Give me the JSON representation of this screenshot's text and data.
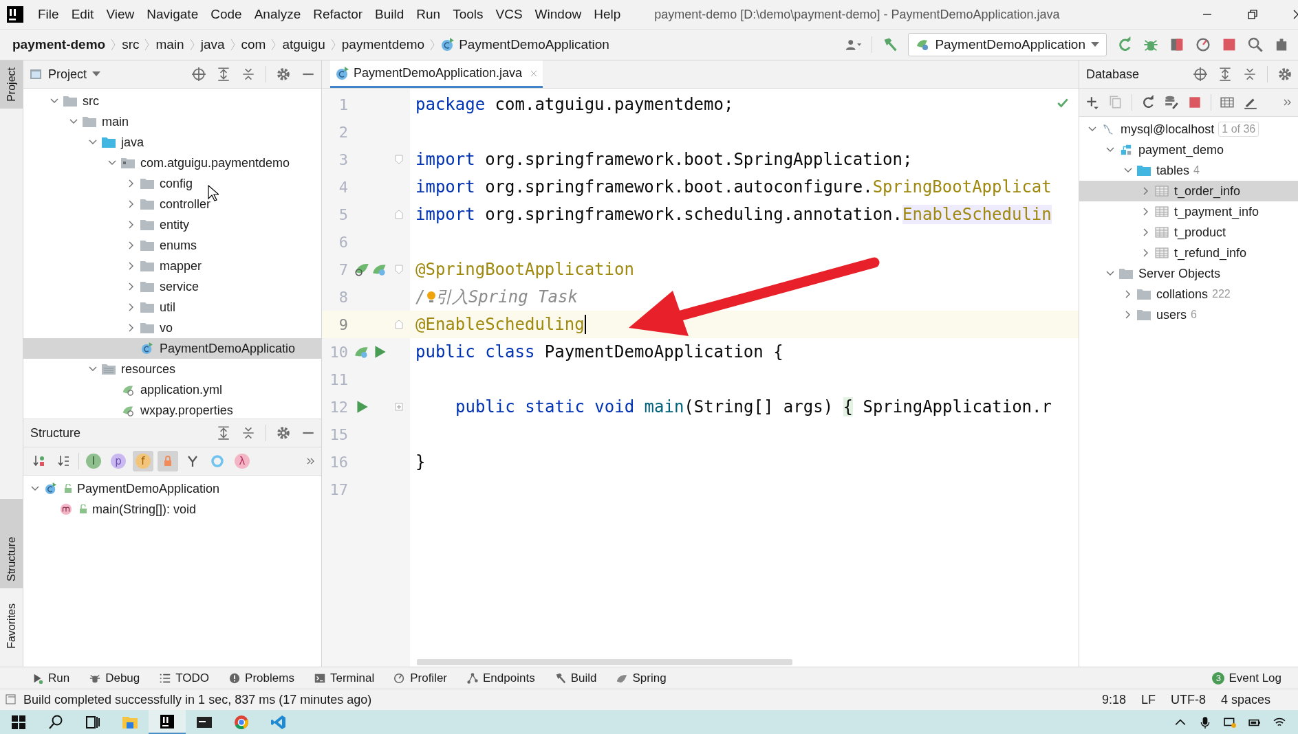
{
  "window": {
    "title": "payment-demo [D:\\demo\\payment-demo] - PaymentDemoApplication.java"
  },
  "menu": [
    "File",
    "Edit",
    "View",
    "Navigate",
    "Code",
    "Analyze",
    "Refactor",
    "Build",
    "Run",
    "Tools",
    "VCS",
    "Window",
    "Help"
  ],
  "breadcrumbs": [
    {
      "label": "payment-demo",
      "kind": "project"
    },
    {
      "label": "src",
      "kind": "dir"
    },
    {
      "label": "main",
      "kind": "dir"
    },
    {
      "label": "java",
      "kind": "dir"
    },
    {
      "label": "com",
      "kind": "dir"
    },
    {
      "label": "atguigu",
      "kind": "dir"
    },
    {
      "label": "paymentdemo",
      "kind": "dir"
    },
    {
      "label": "PaymentDemoApplication",
      "kind": "class"
    }
  ],
  "run_config": {
    "label": "PaymentDemoApplication"
  },
  "left_stripe": [
    {
      "label": "Project",
      "selected": true
    },
    {
      "label": "Structure",
      "selected": true
    },
    {
      "label": "Favorites",
      "selected": false
    }
  ],
  "project": {
    "title": "Project",
    "tree": [
      {
        "label": "src",
        "kind": "folder",
        "expanded": true,
        "selected": false,
        "children": [
          {
            "label": "main",
            "kind": "folder",
            "expanded": true,
            "selected": false,
            "children": [
              {
                "label": "java",
                "kind": "source",
                "expanded": true,
                "selected": false,
                "children": [
                  {
                    "label": "com.atguigu.paymentdemo",
                    "kind": "package",
                    "expanded": true,
                    "selected": false,
                    "children": [
                      {
                        "label": "config",
                        "kind": "folder",
                        "expanded": false,
                        "selected": false
                      },
                      {
                        "label": "controller",
                        "kind": "folder",
                        "expanded": false,
                        "selected": false
                      },
                      {
                        "label": "entity",
                        "kind": "folder",
                        "expanded": false,
                        "selected": false
                      },
                      {
                        "label": "enums",
                        "kind": "folder",
                        "expanded": false,
                        "selected": false
                      },
                      {
                        "label": "mapper",
                        "kind": "folder",
                        "expanded": false,
                        "selected": false
                      },
                      {
                        "label": "service",
                        "kind": "folder",
                        "expanded": false,
                        "selected": false
                      },
                      {
                        "label": "util",
                        "kind": "folder",
                        "expanded": false,
                        "selected": false
                      },
                      {
                        "label": "vo",
                        "kind": "folder",
                        "expanded": false,
                        "selected": false
                      },
                      {
                        "label": "PaymentDemoApplicatio",
                        "kind": "class",
                        "selected": true
                      }
                    ]
                  }
                ]
              },
              {
                "label": "resources",
                "kind": "resources",
                "expanded": true,
                "selected": false,
                "children": [
                  {
                    "label": "application.yml",
                    "kind": "config-file",
                    "selected": false
                  },
                  {
                    "label": "wxpay.properties",
                    "kind": "config-file",
                    "selected": false
                  }
                ]
              }
            ]
          }
        ]
      }
    ]
  },
  "structure": {
    "title": "Structure",
    "filters": [
      {
        "kind": "sort-visibility",
        "selected": false
      },
      {
        "kind": "sort-alpha",
        "selected": false
      },
      {
        "kind": "inherited",
        "glyph": "I",
        "selected": false
      },
      {
        "kind": "properties",
        "glyph": "p",
        "selected": false
      },
      {
        "kind": "fields",
        "glyph": "f",
        "selected": true
      },
      {
        "kind": "non-public",
        "selected": true
      },
      {
        "kind": "anonymous",
        "selected": false
      },
      {
        "kind": "ring",
        "selected": false
      },
      {
        "kind": "lambdas",
        "glyph": "λ",
        "selected": false
      }
    ],
    "tree": [
      {
        "label": "PaymentDemoApplication",
        "kind": "class",
        "expanded": true,
        "selected": false,
        "children": [
          {
            "label": "main(String[]): void",
            "kind": "method",
            "selected": false
          }
        ]
      }
    ]
  },
  "editor": {
    "tabs": [
      {
        "label": "PaymentDemoApplication.java",
        "selected": true
      }
    ],
    "lines": [
      {
        "number": "1",
        "tokens": [
          {
            "kind": "keyword",
            "text": "package"
          },
          {
            "kind": "plain",
            "text": " com.atguigu.paymentdemo;"
          }
        ]
      },
      {
        "number": "2"
      },
      {
        "number": "3",
        "fold": {
          "kind": "open"
        },
        "tokens": [
          {
            "kind": "keyword",
            "text": "import"
          },
          {
            "kind": "plain",
            "text": " org.springframework.boot.SpringApplication;"
          }
        ]
      },
      {
        "number": "4",
        "tokens": [
          {
            "kind": "keyword",
            "text": "import"
          },
          {
            "kind": "plain",
            "text": " org.springframework.boot.autoconfigure."
          },
          {
            "kind": "annotation",
            "text": "SpringBootApplicat"
          }
        ]
      },
      {
        "number": "5",
        "fold": {
          "kind": "close"
        },
        "tokens": [
          {
            "kind": "keyword",
            "text": "import"
          },
          {
            "kind": "plain",
            "text": " org.springframework.scheduling.annotation."
          },
          {
            "kind": "highlight",
            "text": "EnableSchedulin"
          }
        ]
      },
      {
        "number": "6"
      },
      {
        "number": "7",
        "fold": {
          "kind": "open"
        },
        "markers": [
          {
            "kind": "search-bean"
          },
          {
            "kind": "bean"
          }
        ],
        "tokens": [
          {
            "kind": "annotation",
            "text": "@SpringBootApplication"
          }
        ]
      },
      {
        "number": "8",
        "tokens": [
          {
            "kind": "comment",
            "text": "/"
          },
          {
            "kind": "bulb"
          },
          {
            "kind": "comment",
            "text": "引入Spring Task"
          }
        ]
      },
      {
        "number": "9",
        "fold": {
          "kind": "close"
        },
        "current": true,
        "tokens": [
          {
            "kind": "annotation",
            "text": "@EnableScheduling"
          }
        ]
      },
      {
        "number": "10",
        "markers": [
          {
            "kind": "bean"
          },
          {
            "kind": "run"
          }
        ],
        "tokens": [
          {
            "kind": "keyword",
            "text": "public class"
          },
          {
            "kind": "plain",
            "text": " PaymentDemoApplication {"
          }
        ]
      },
      {
        "number": "11"
      },
      {
        "number": "12",
        "fold": {
          "kind": "collapsed"
        },
        "indented": true,
        "markers": [
          {
            "kind": "run"
          }
        ],
        "tokens": [
          {
            "kind": "keyword",
            "text": "public static void"
          },
          {
            "kind": "method",
            "text": " main"
          },
          {
            "kind": "plain",
            "text": "(String[] args) "
          },
          {
            "kind": "folded",
            "text": "{"
          },
          {
            "kind": "plain",
            "text": " SpringApplication.r"
          }
        ]
      },
      {
        "number": "15"
      },
      {
        "number": "16",
        "tokens": [
          {
            "kind": "plain",
            "text": "}"
          }
        ]
      },
      {
        "number": "17"
      }
    ]
  },
  "database": {
    "title": "Database",
    "tree": [
      {
        "label": "mysql@localhost",
        "kind": "connection",
        "badge": "1 of 36",
        "expanded": true,
        "selected": false,
        "children": [
          {
            "label": "payment_demo",
            "kind": "schema",
            "expanded": true,
            "selected": false,
            "children": [
              {
                "label": "tables",
                "kind": "tables",
                "count": "4",
                "expanded": true,
                "selected": false,
                "children": [
                  {
                    "label": "t_order_info",
                    "kind": "table",
                    "expanded": false,
                    "selected": true
                  },
                  {
                    "label": "t_payment_info",
                    "kind": "table",
                    "expanded": false,
                    "selected": false
                  },
                  {
                    "label": "t_product",
                    "kind": "table",
                    "expanded": false,
                    "selected": false
                  },
                  {
                    "label": "t_refund_info",
                    "kind": "table",
                    "expanded": false,
                    "selected": false
                  }
                ]
              }
            ]
          },
          {
            "label": "Server Objects",
            "kind": "folder",
            "expanded": true,
            "selected": false,
            "children": [
              {
                "label": "collations",
                "kind": "folder",
                "count": "222",
                "expanded": false,
                "selected": false
              },
              {
                "label": "users",
                "kind": "folder",
                "count": "6",
                "expanded": false,
                "selected": false
              }
            ]
          }
        ]
      }
    ]
  },
  "tool_windows": [
    {
      "label": "Run",
      "kind": "run"
    },
    {
      "label": "Debug",
      "kind": "debug"
    },
    {
      "label": "TODO",
      "kind": "todo"
    },
    {
      "label": "Problems",
      "kind": "problems"
    },
    {
      "label": "Terminal",
      "kind": "terminal"
    },
    {
      "label": "Profiler",
      "kind": "profiler"
    },
    {
      "label": "Endpoints",
      "kind": "endpoints"
    },
    {
      "label": "Build",
      "kind": "build"
    },
    {
      "label": "Spring",
      "kind": "spring"
    }
  ],
  "event_log": {
    "label": "Event Log",
    "count": "3"
  },
  "status_bar": {
    "message": "Build completed successfully in 1 sec, 837 ms (17 minutes ago)",
    "items": [
      "9:18",
      "LF",
      "UTF-8",
      "4 spaces"
    ]
  },
  "taskbar": [
    {
      "kind": "start",
      "selected": false
    },
    {
      "kind": "search",
      "selected": false
    },
    {
      "kind": "task-view",
      "selected": false
    },
    {
      "kind": "explorer",
      "selected": false
    },
    {
      "kind": "ide",
      "selected": true
    },
    {
      "kind": "console",
      "selected": false
    },
    {
      "kind": "browser",
      "selected": false
    },
    {
      "kind": "code-editor",
      "selected": false
    }
  ]
}
